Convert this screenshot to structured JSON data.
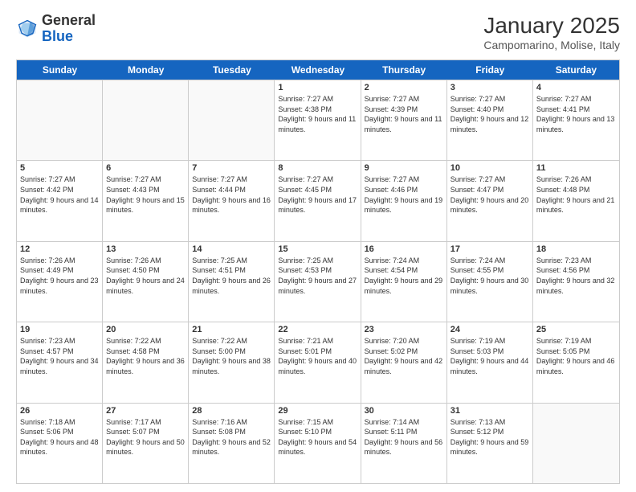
{
  "header": {
    "logo_general": "General",
    "logo_blue": "Blue",
    "month_title": "January 2025",
    "location": "Campomarino, Molise, Italy"
  },
  "weekdays": [
    "Sunday",
    "Monday",
    "Tuesday",
    "Wednesday",
    "Thursday",
    "Friday",
    "Saturday"
  ],
  "weeks": [
    [
      {
        "day": "",
        "empty": true
      },
      {
        "day": "",
        "empty": true
      },
      {
        "day": "",
        "empty": true
      },
      {
        "day": "1",
        "sunrise": "7:27 AM",
        "sunset": "4:38 PM",
        "daylight": "9 hours and 11 minutes."
      },
      {
        "day": "2",
        "sunrise": "7:27 AM",
        "sunset": "4:39 PM",
        "daylight": "9 hours and 11 minutes."
      },
      {
        "day": "3",
        "sunrise": "7:27 AM",
        "sunset": "4:40 PM",
        "daylight": "9 hours and 12 minutes."
      },
      {
        "day": "4",
        "sunrise": "7:27 AM",
        "sunset": "4:41 PM",
        "daylight": "9 hours and 13 minutes."
      }
    ],
    [
      {
        "day": "5",
        "sunrise": "7:27 AM",
        "sunset": "4:42 PM",
        "daylight": "9 hours and 14 minutes."
      },
      {
        "day": "6",
        "sunrise": "7:27 AM",
        "sunset": "4:43 PM",
        "daylight": "9 hours and 15 minutes."
      },
      {
        "day": "7",
        "sunrise": "7:27 AM",
        "sunset": "4:44 PM",
        "daylight": "9 hours and 16 minutes."
      },
      {
        "day": "8",
        "sunrise": "7:27 AM",
        "sunset": "4:45 PM",
        "daylight": "9 hours and 17 minutes."
      },
      {
        "day": "9",
        "sunrise": "7:27 AM",
        "sunset": "4:46 PM",
        "daylight": "9 hours and 19 minutes."
      },
      {
        "day": "10",
        "sunrise": "7:27 AM",
        "sunset": "4:47 PM",
        "daylight": "9 hours and 20 minutes."
      },
      {
        "day": "11",
        "sunrise": "7:26 AM",
        "sunset": "4:48 PM",
        "daylight": "9 hours and 21 minutes."
      }
    ],
    [
      {
        "day": "12",
        "sunrise": "7:26 AM",
        "sunset": "4:49 PM",
        "daylight": "9 hours and 23 minutes."
      },
      {
        "day": "13",
        "sunrise": "7:26 AM",
        "sunset": "4:50 PM",
        "daylight": "9 hours and 24 minutes."
      },
      {
        "day": "14",
        "sunrise": "7:25 AM",
        "sunset": "4:51 PM",
        "daylight": "9 hours and 26 minutes."
      },
      {
        "day": "15",
        "sunrise": "7:25 AM",
        "sunset": "4:53 PM",
        "daylight": "9 hours and 27 minutes."
      },
      {
        "day": "16",
        "sunrise": "7:24 AM",
        "sunset": "4:54 PM",
        "daylight": "9 hours and 29 minutes."
      },
      {
        "day": "17",
        "sunrise": "7:24 AM",
        "sunset": "4:55 PM",
        "daylight": "9 hours and 30 minutes."
      },
      {
        "day": "18",
        "sunrise": "7:23 AM",
        "sunset": "4:56 PM",
        "daylight": "9 hours and 32 minutes."
      }
    ],
    [
      {
        "day": "19",
        "sunrise": "7:23 AM",
        "sunset": "4:57 PM",
        "daylight": "9 hours and 34 minutes."
      },
      {
        "day": "20",
        "sunrise": "7:22 AM",
        "sunset": "4:58 PM",
        "daylight": "9 hours and 36 minutes."
      },
      {
        "day": "21",
        "sunrise": "7:22 AM",
        "sunset": "5:00 PM",
        "daylight": "9 hours and 38 minutes."
      },
      {
        "day": "22",
        "sunrise": "7:21 AM",
        "sunset": "5:01 PM",
        "daylight": "9 hours and 40 minutes."
      },
      {
        "day": "23",
        "sunrise": "7:20 AM",
        "sunset": "5:02 PM",
        "daylight": "9 hours and 42 minutes."
      },
      {
        "day": "24",
        "sunrise": "7:19 AM",
        "sunset": "5:03 PM",
        "daylight": "9 hours and 44 minutes."
      },
      {
        "day": "25",
        "sunrise": "7:19 AM",
        "sunset": "5:05 PM",
        "daylight": "9 hours and 46 minutes."
      }
    ],
    [
      {
        "day": "26",
        "sunrise": "7:18 AM",
        "sunset": "5:06 PM",
        "daylight": "9 hours and 48 minutes."
      },
      {
        "day": "27",
        "sunrise": "7:17 AM",
        "sunset": "5:07 PM",
        "daylight": "9 hours and 50 minutes."
      },
      {
        "day": "28",
        "sunrise": "7:16 AM",
        "sunset": "5:08 PM",
        "daylight": "9 hours and 52 minutes."
      },
      {
        "day": "29",
        "sunrise": "7:15 AM",
        "sunset": "5:10 PM",
        "daylight": "9 hours and 54 minutes."
      },
      {
        "day": "30",
        "sunrise": "7:14 AM",
        "sunset": "5:11 PM",
        "daylight": "9 hours and 56 minutes."
      },
      {
        "day": "31",
        "sunrise": "7:13 AM",
        "sunset": "5:12 PM",
        "daylight": "9 hours and 59 minutes."
      },
      {
        "day": "",
        "empty": true
      }
    ]
  ]
}
